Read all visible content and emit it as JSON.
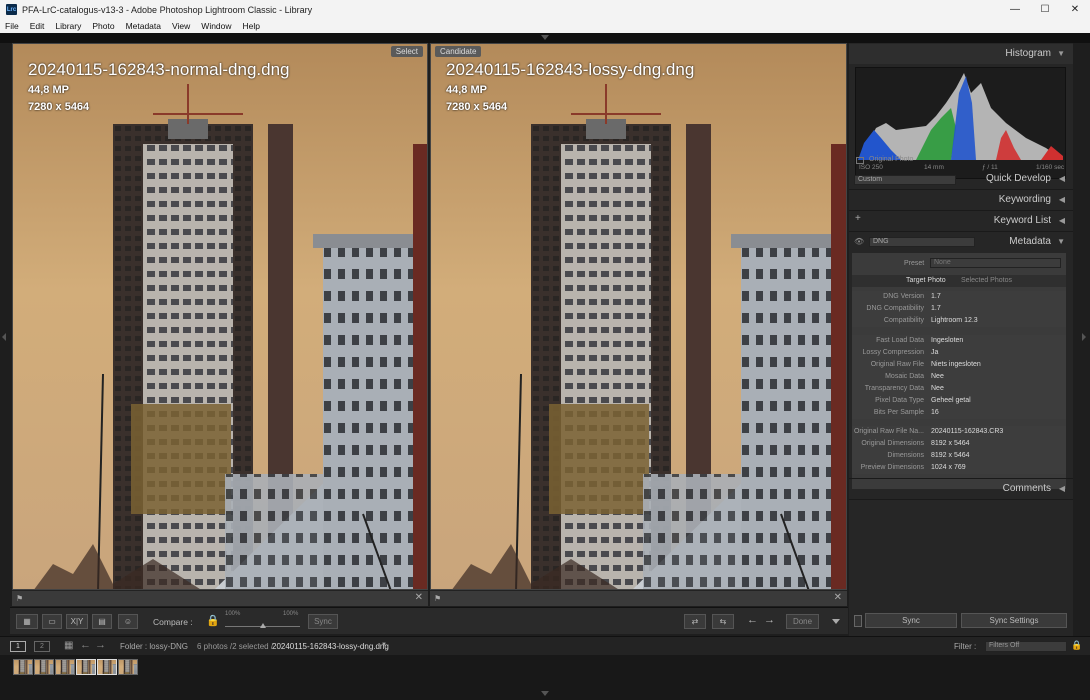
{
  "window": {
    "title": "PFA-LrC-catalogus-v13-3 - Adobe Photoshop Lightroom Classic - Library",
    "app_icon": "Lrc",
    "min": "—",
    "max": "☐",
    "close": "✕"
  },
  "menu": [
    "File",
    "Edit",
    "Library",
    "Photo",
    "Metadata",
    "View",
    "Window",
    "Help"
  ],
  "compare": {
    "left": {
      "tag": "Select",
      "filename": "20240115-162843-normal-dng.dng",
      "mp": "44,8 MP",
      "dims": "7280 x 5464"
    },
    "right": {
      "tag": "Candidate",
      "filename": "20240115-162843-lossy-dng.dng",
      "mp": "44,8 MP",
      "dims": "7280 x 5464"
    }
  },
  "toolbar": {
    "compare_label": "Compare :",
    "zoom_left": "100%",
    "zoom_right": "100%",
    "sync": "Sync",
    "done": "Done",
    "xy": "X|Y"
  },
  "right_panel": {
    "histogram": {
      "title": "Histogram",
      "iso": "ISO 250",
      "focal": "14 mm",
      "aperture": "ƒ / 11",
      "shutter": "1/160 sec",
      "original_photo": "Original Photo"
    },
    "quick_develop": {
      "title": "Quick Develop",
      "preset": "Custom"
    },
    "keywording": {
      "title": "Keywording"
    },
    "keyword_list": {
      "title": "Keyword List",
      "add": "+"
    },
    "metadata": {
      "title": "Metadata",
      "set": "DNG",
      "preset_label": "Preset",
      "preset_value": "None",
      "tab_target": "Target Photo",
      "tab_selected": "Selected Photos",
      "rows": [
        {
          "k": "DNG Version",
          "v": "1.7"
        },
        {
          "k": "DNG Compatibility",
          "v": "1.7"
        },
        {
          "k": "Compatibility",
          "v": "Lightroom 12.3"
        },
        {
          "k": "Fast Load Data",
          "v": "Ingesloten"
        },
        {
          "k": "Lossy Compression",
          "v": "Ja"
        },
        {
          "k": "Original Raw File",
          "v": "Niets ingesloten"
        },
        {
          "k": "Mosaic Data",
          "v": "Nee"
        },
        {
          "k": "Transparency Data",
          "v": "Nee"
        },
        {
          "k": "Pixel Data Type",
          "v": "Geheel getal"
        },
        {
          "k": "Bits Per Sample",
          "v": "16"
        },
        {
          "k": "Original Raw File Na...",
          "v": "20240115-162843.CR3"
        },
        {
          "k": "Original Dimensions",
          "v": "8192 x 5464"
        },
        {
          "k": "Dimensions",
          "v": "8192 x 5464"
        },
        {
          "k": "Preview Dimensions",
          "v": "1024 x 769"
        }
      ]
    },
    "comments": {
      "title": "Comments"
    },
    "sync": "Sync",
    "sync_settings": "Sync Settings"
  },
  "filmbar": {
    "screen1": "1",
    "screen2": "2",
    "folder": "Folder : lossy-DNG",
    "count": "6 photos /2 selected /",
    "current": "20240115-162843-lossy-dng.dng",
    "filter_label": "Filter :",
    "filter_value": "Filters Off"
  },
  "colors": {
    "accent": "#f5c27a",
    "panel": "#262626",
    "background": "#1e1e1e"
  }
}
